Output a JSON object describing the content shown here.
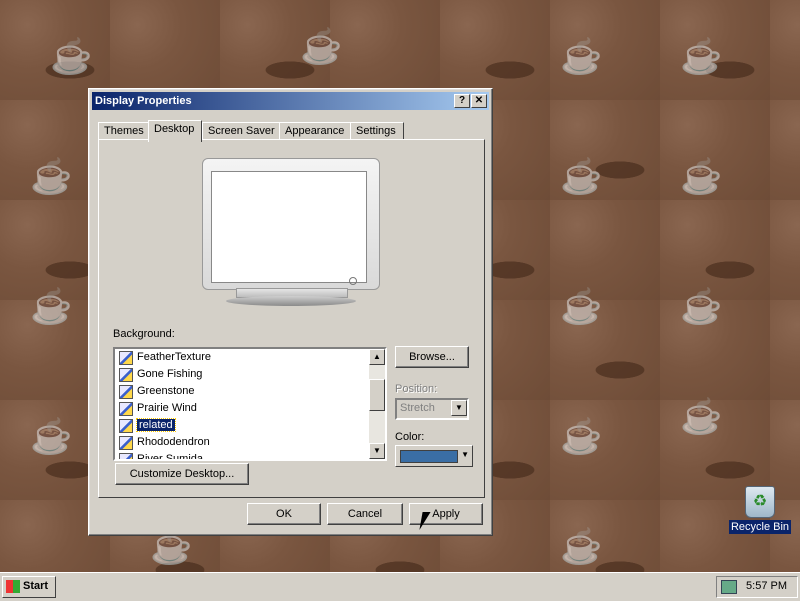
{
  "window": {
    "title": "Display Properties",
    "help_icon": "?",
    "close_icon": "✕"
  },
  "tabs": [
    {
      "label": "Themes"
    },
    {
      "label": "Desktop"
    },
    {
      "label": "Screen Saver"
    },
    {
      "label": "Appearance"
    },
    {
      "label": "Settings"
    }
  ],
  "active_tab": "Desktop",
  "desktop_tab": {
    "background_label": "Background:",
    "background_list": [
      {
        "name": "FeatherTexture",
        "selected": false
      },
      {
        "name": "Gone Fishing",
        "selected": false
      },
      {
        "name": "Greenstone",
        "selected": false
      },
      {
        "name": "Prairie Wind",
        "selected": false
      },
      {
        "name": "related",
        "selected": true
      },
      {
        "name": "Rhododendron",
        "selected": false
      },
      {
        "name": "River Sumida",
        "selected": false
      }
    ],
    "browse_button": "Browse...",
    "position_label": "Position:",
    "position_value": "Stretch",
    "color_label": "Color:",
    "color_value": "#3a6ea5",
    "customize_button": "Customize Desktop..."
  },
  "dialog_buttons": {
    "ok": "OK",
    "cancel": "Cancel",
    "apply": "Apply"
  },
  "desktop_icons": [
    {
      "label": "Recycle Bin",
      "icon": "recycle-bin-icon"
    }
  ],
  "taskbar": {
    "start_label": "Start",
    "clock": "5:57 PM"
  }
}
